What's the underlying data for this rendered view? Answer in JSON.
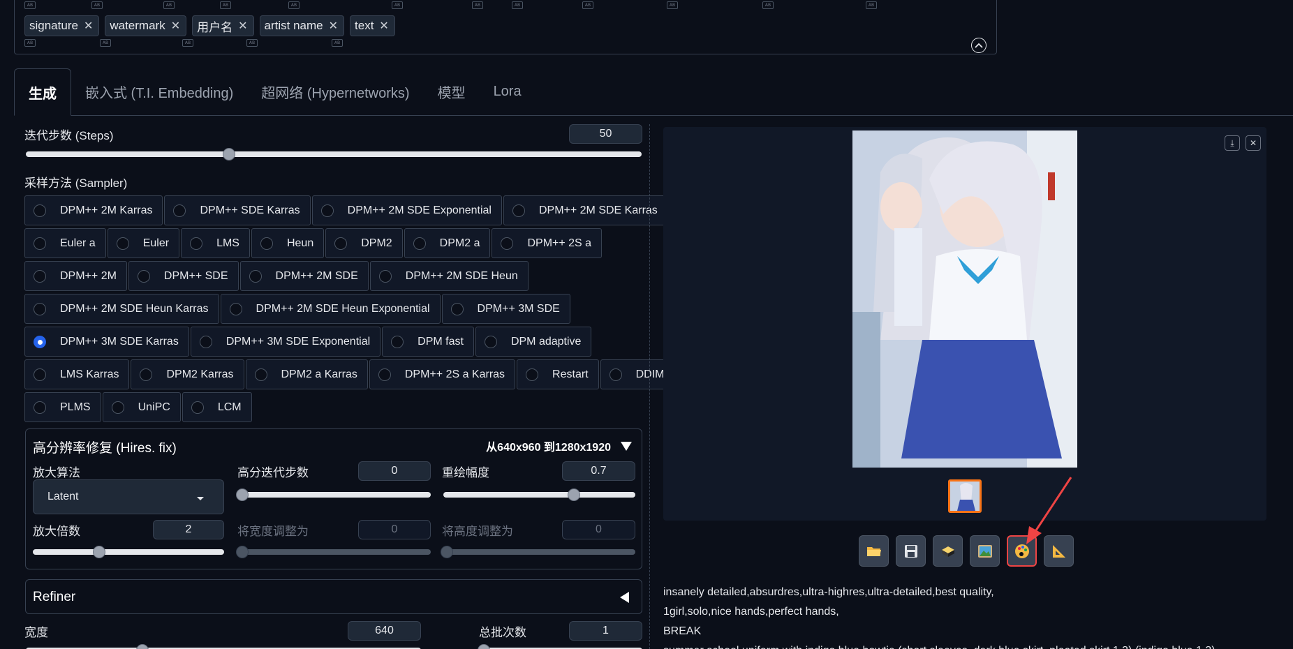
{
  "negative_tags": [
    "signature",
    "watermark",
    "用户名",
    "artist name",
    "text"
  ],
  "tabs": [
    "生成",
    "嵌入式 (T.I. Embedding)",
    "超网络 (Hypernetworks)",
    "模型",
    "Lora"
  ],
  "steps": {
    "label": "迭代步数 (Steps)",
    "value": "50",
    "fraction": 0.33
  },
  "sampler": {
    "label": "采样方法 (Sampler)",
    "selected": "DPM++ 3M SDE Karras",
    "rows": [
      [
        "DPM++ 2M Karras",
        "DPM++ SDE Karras",
        "DPM++ 2M SDE Exponential",
        "DPM++ 2M SDE Karras"
      ],
      [
        "Euler a",
        "Euler",
        "LMS",
        "Heun",
        "DPM2",
        "DPM2 a",
        "DPM++ 2S a"
      ],
      [
        "DPM++ 2M",
        "DPM++ SDE",
        "DPM++ 2M SDE",
        "DPM++ 2M SDE Heun"
      ],
      [
        "DPM++ 2M SDE Heun Karras",
        "DPM++ 2M SDE Heun Exponential",
        "DPM++ 3M SDE"
      ],
      [
        "DPM++ 3M SDE Karras",
        "DPM++ 3M SDE Exponential",
        "DPM fast",
        "DPM adaptive"
      ],
      [
        "LMS Karras",
        "DPM2 Karras",
        "DPM2 a Karras",
        "DPM++ 2S a Karras",
        "Restart",
        "DDIM"
      ],
      [
        "PLMS",
        "UniPC",
        "LCM"
      ]
    ]
  },
  "hires": {
    "title": "高分辨率修复 (Hires. fix)",
    "info": "从640x960 到1280x1920",
    "upscaler_label": "放大算法",
    "upscaler_value": "Latent",
    "hires_steps_label": "高分迭代步数",
    "hires_steps_value": "0",
    "denoise_label": "重绘幅度",
    "denoise_value": "0.7",
    "scale_label": "放大倍数",
    "scale_value": "2",
    "resize_w_label": "将宽度调整为",
    "resize_w_value": "0",
    "resize_h_label": "将高度调整为",
    "resize_h_value": "0"
  },
  "refiner": {
    "title": "Refiner"
  },
  "width": {
    "label": "宽度",
    "value": "640"
  },
  "batch_count": {
    "label": "总批次数",
    "value": "1"
  },
  "output_prompt": [
    "insanely detailed,absurdres,ultra-highres,ultra-detailed,best quality,",
    "1girl,solo,nice hands,perfect hands,",
    "BREAK",
    "summer school uniform with indigo blue bowtie (short sleeves, dark blue skirt, pleated skirt 1.3) (indigo blue 1.3)"
  ],
  "tool_icons": [
    "folder-icon",
    "save-icon",
    "zip-icon",
    "image-icon",
    "palette-icon",
    "ruler-icon"
  ],
  "colors": {
    "accent": "#2563eb",
    "thumb_border": "#f97316",
    "highlight": "#ef4444"
  }
}
